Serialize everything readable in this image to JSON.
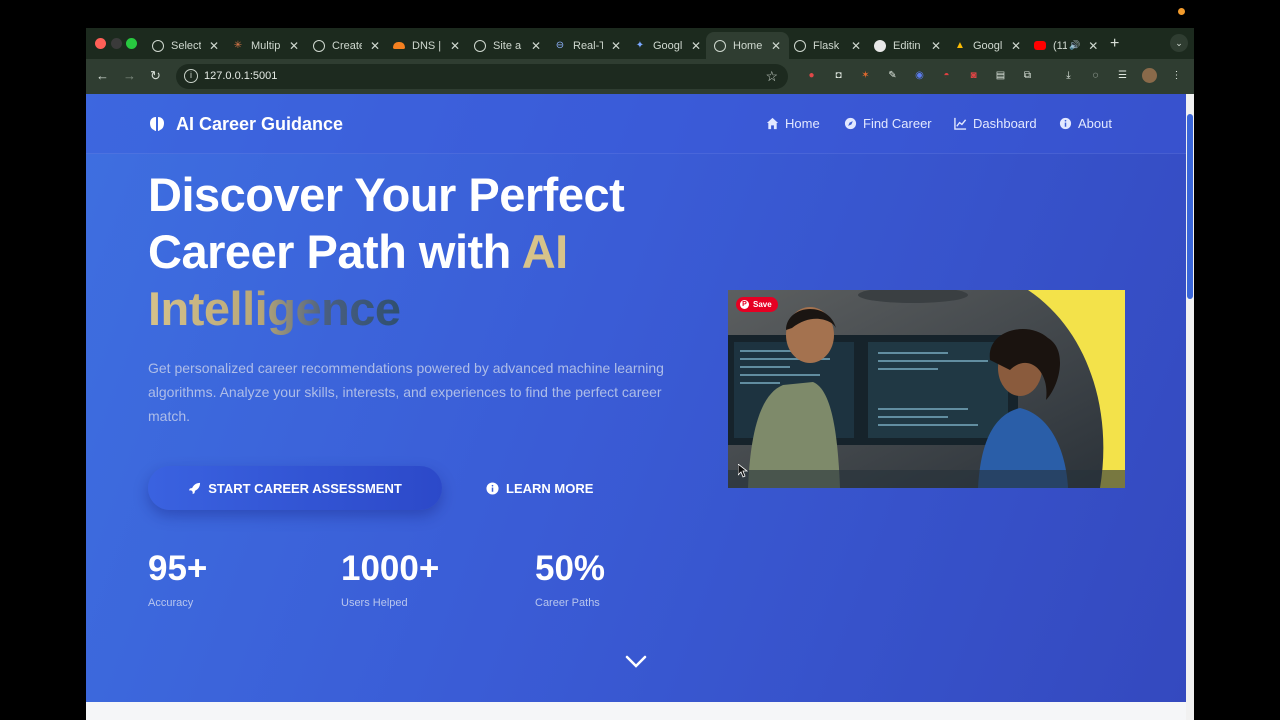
{
  "browser": {
    "tabs": [
      {
        "label": "Select",
        "icon": "globe-icon"
      },
      {
        "label": "Multip",
        "icon": "claude-icon"
      },
      {
        "label": "Create",
        "icon": "openai-icon"
      },
      {
        "label": "DNS |",
        "icon": "cloudflare-icon"
      },
      {
        "label": "Site a",
        "icon": "globe-icon"
      },
      {
        "label": "Real-T",
        "icon": "link-icon"
      },
      {
        "label": "Googl",
        "icon": "gemini-icon"
      },
      {
        "label": "Home",
        "icon": "globe-icon",
        "active": true
      },
      {
        "label": "Flask",
        "icon": "openai-icon"
      },
      {
        "label": "Editin",
        "icon": "github-icon"
      },
      {
        "label": "Googl",
        "icon": "drive-icon"
      },
      {
        "label": "(11",
        "icon": "youtube-icon"
      }
    ],
    "url": "127.0.0.1:5001"
  },
  "nav": {
    "brand": "AI Career Guidance",
    "links": [
      {
        "label": "Home",
        "icon": "home-icon"
      },
      {
        "label": "Find Career",
        "icon": "compass-icon"
      },
      {
        "label": "Dashboard",
        "icon": "chart-line-icon"
      },
      {
        "label": "About",
        "icon": "info-icon"
      }
    ]
  },
  "hero": {
    "title_line1": "Discover Your Perfect",
    "title_line2a": "Career Path with ",
    "title_line2b": "AI",
    "title_line3": "Intelligence",
    "subtitle": "Get personalized career recommendations powered by advanced machine learning algorithms. Analyze your skills, interests, and experiences to find the perfect career match.",
    "primary_button": "START CAREER ASSESSMENT",
    "secondary_button": "LEARN MORE",
    "image_save_label": "Save"
  },
  "stats": [
    {
      "value": "95+",
      "label": "Accuracy"
    },
    {
      "value": "1000+",
      "label": "Users Helped"
    },
    {
      "value": "50%",
      "label": "Career Paths"
    }
  ],
  "colors": {
    "accent_gold": "#d7c38a",
    "hero_blue": "#3a5cd6",
    "pinterest_red": "#e60023"
  }
}
